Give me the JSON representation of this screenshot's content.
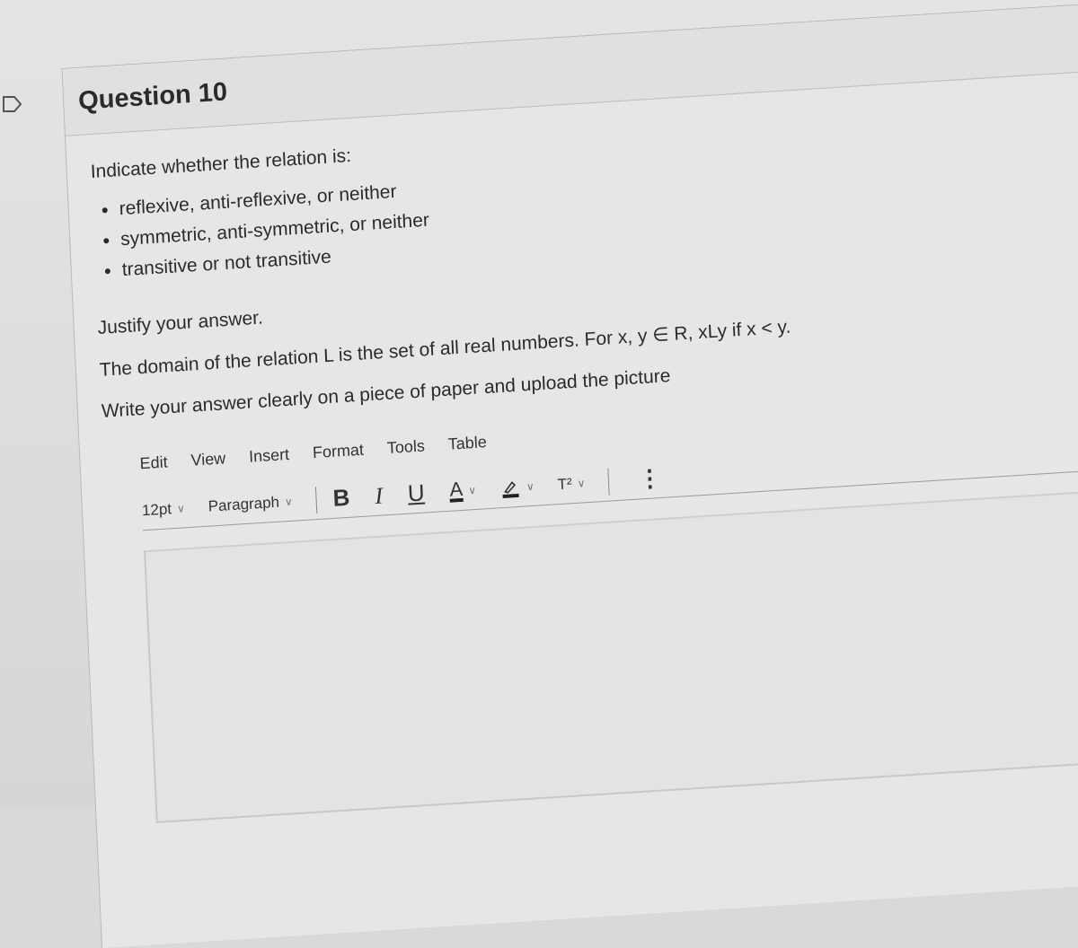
{
  "question": {
    "title": "Question 10",
    "intro": "Indicate whether the relation is:",
    "options": [
      "reflexive, anti-reflexive, or neither",
      "symmetric, anti-symmetric, or neither",
      "transitive or not transitive"
    ],
    "justify": "Justify your answer.",
    "domain_text": "The domain of the relation L is the set of all real numbers. For x, y ∈ R, xLy if x < y.",
    "instruction": "Write your answer clearly on a piece of paper and upload the picture"
  },
  "editor": {
    "menu": [
      "Edit",
      "View",
      "Insert",
      "Format",
      "Tools",
      "Table"
    ],
    "font_size": "12pt",
    "block_format": "Paragraph",
    "bold": "B",
    "italic": "I",
    "underline": "U",
    "text_color": "A",
    "superscript": "T²",
    "more": "⋮",
    "chevron": "∨",
    "content": ""
  }
}
